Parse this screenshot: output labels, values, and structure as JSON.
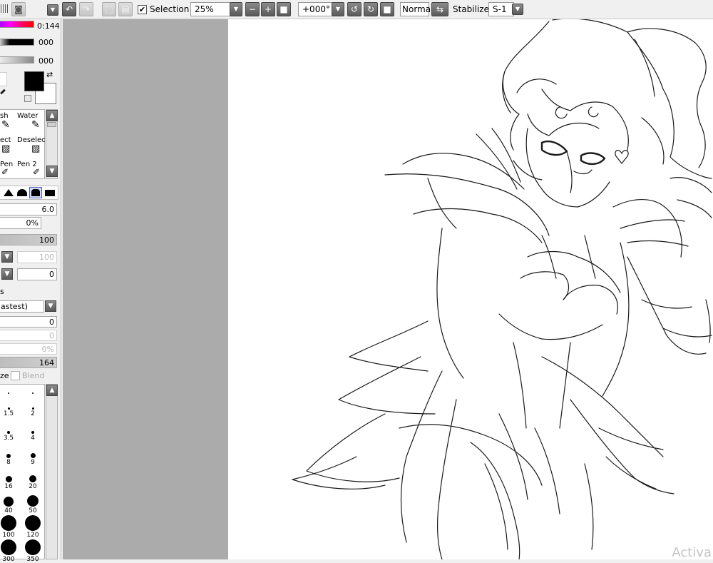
{
  "toolbar": {
    "selection_label": "Selection",
    "selection_checked": "✔",
    "zoom_value": "25%",
    "rotation_value": "+000°",
    "blend_mode": "Normal",
    "stabilizer_label": "Stabilizer",
    "stabilizer_value": "S-1"
  },
  "color_panel": {
    "hue_value": "0:144",
    "sat_value": "000",
    "lum_value": "000",
    "primary_color": "#000000",
    "secondary_color": "#ffffff"
  },
  "tools": [
    {
      "label": "sh"
    },
    {
      "label": "Water"
    },
    {
      "label": "ect"
    },
    {
      "label": "Deselect"
    },
    {
      "label": "Pen"
    },
    {
      "label": "Pen 2"
    }
  ],
  "brush_settings": {
    "size_value": "6.0",
    "min_size_value": "0%",
    "density_value": "100",
    "row_a_value": "100",
    "row_b_value": "0",
    "section_label": "s",
    "quality_value": "astest)",
    "blur_value": "0",
    "blur2_value": "0",
    "percent2_value": "0%",
    "persistence_value": "164",
    "size_label": "ze",
    "blend_label": "Blend"
  },
  "brush_sizes": [
    "1.5",
    "2",
    "3.5",
    "4",
    "8",
    "9",
    "16",
    "20",
    "40",
    "50",
    "100",
    "120",
    "300",
    "350"
  ],
  "watermark_text": "Activa"
}
